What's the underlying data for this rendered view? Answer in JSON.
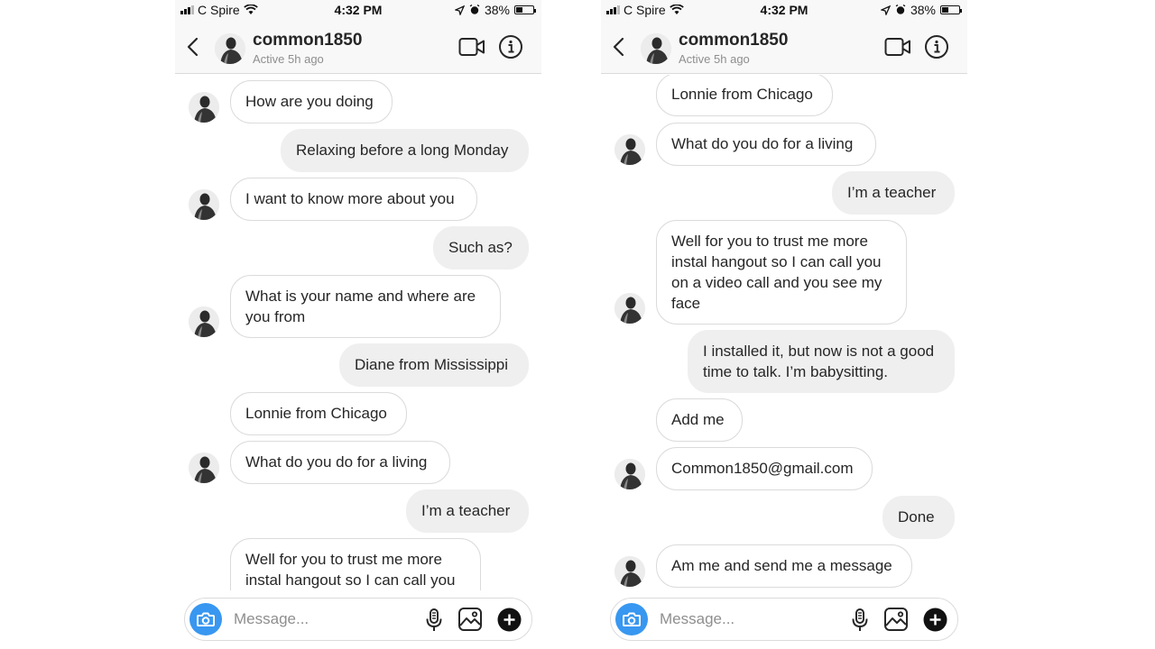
{
  "status_bar": {
    "carrier": "C Spire",
    "time": "4:32 PM",
    "battery": "38%",
    "battery_level": 0.38
  },
  "header": {
    "username": "common1850",
    "active_status": "Active 5h ago"
  },
  "composer": {
    "placeholder": "Message..."
  },
  "icons": {
    "back": "chevron-left-icon",
    "video": "video-call-icon",
    "info": "info-icon",
    "camera": "camera-icon",
    "mic": "microphone-icon",
    "gallery": "gallery-icon",
    "plus": "plus-icon"
  },
  "colors": {
    "camera_button": "#3897f0",
    "outgoing_bubble": "#efefef",
    "incoming_border": "#dbdbdb",
    "secondary_text": "#8e8e8e"
  },
  "left_screen": {
    "messages": [
      {
        "from": "them",
        "text": "How are you doing",
        "avatar": true
      },
      {
        "from": "me",
        "text": "Relaxing before a long Monday"
      },
      {
        "from": "them",
        "text": "I want to know more about you",
        "avatar": true
      },
      {
        "from": "me",
        "text": "Such as?"
      },
      {
        "from": "them",
        "text": "What is your name and where are you from",
        "avatar": true
      },
      {
        "from": "me",
        "text": "Diane from Mississippi"
      },
      {
        "from": "them",
        "text": "Lonnie from Chicago",
        "avatar": false
      },
      {
        "from": "them",
        "text": "What do you do for a living",
        "avatar": true
      },
      {
        "from": "me",
        "text": "I’m a teacher"
      },
      {
        "from": "them",
        "text": "Well for you to trust me more instal hangout so I can call you",
        "avatar": false
      }
    ]
  },
  "right_screen": {
    "messages": [
      {
        "from": "them",
        "text": "Lonnie from Chicago",
        "avatar": false
      },
      {
        "from": "them",
        "text": "What do you do for a living",
        "avatar": true
      },
      {
        "from": "me",
        "text": "I’m a teacher"
      },
      {
        "from": "them",
        "text": "Well for you to trust me more instal hangout so I can call you on a video call and you see my face",
        "avatar": true
      },
      {
        "from": "me",
        "text": "I installed it, but now is not a good time to talk. I’m babysitting."
      },
      {
        "from": "them",
        "text": "Add me",
        "avatar": false
      },
      {
        "from": "them",
        "text": "Common1850@gmail.com",
        "avatar": true
      },
      {
        "from": "me",
        "text": "Done"
      },
      {
        "from": "them",
        "text": "Am me and send me a message",
        "avatar": true
      }
    ]
  }
}
